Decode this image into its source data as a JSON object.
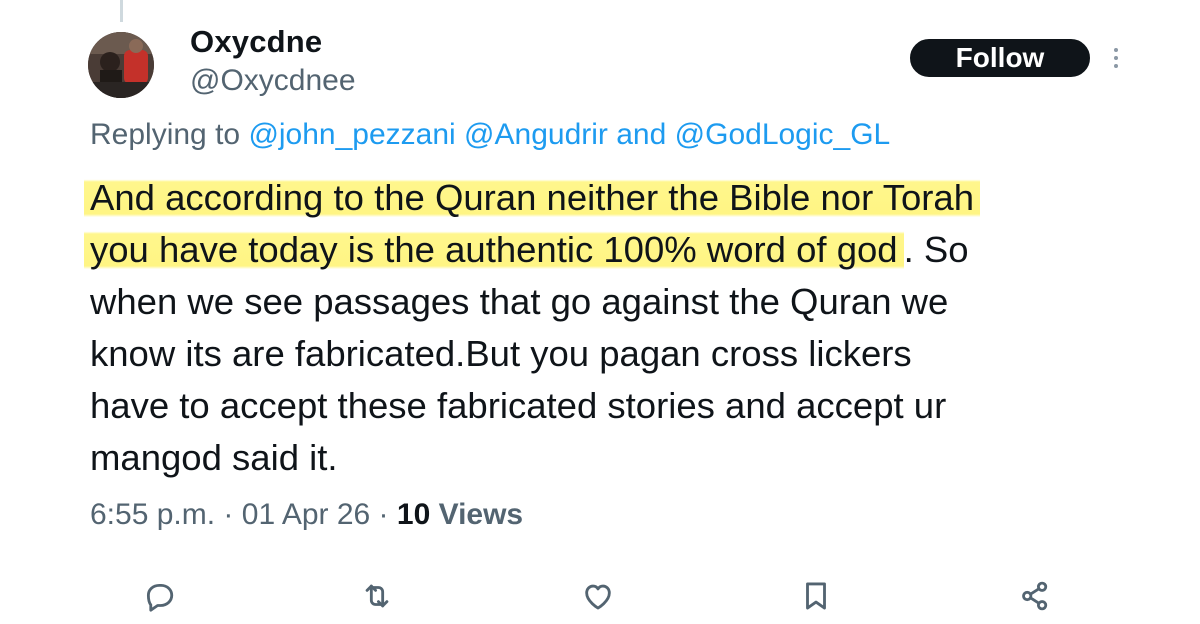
{
  "tweet": {
    "author": {
      "display_name": "Oxycdne",
      "handle": "@Oxycdnee"
    },
    "follow_label": "Follow",
    "reply_prefix": "Replying to",
    "reply_mentions": [
      "@john_pezzani",
      "@Angudrir"
    ],
    "reply_joiner": "and",
    "reply_last_mention": "@GodLogic_GL",
    "body_lines": [
      "And according to the Quran neither the Bible nor Torah",
      "you have today is the authentic 100% word of god",
      ". So",
      "when we see passages that go against the Quran we",
      "know its are fabricated.But you pagan cross lickers",
      "have to accept these fabricated stories and accept ur",
      "mangod said it."
    ],
    "time": "6:55 p.m.",
    "date": "01 Apr 26",
    "separator": "·",
    "views_count": "10",
    "views_label": "Views"
  },
  "actions": [
    {
      "name": "reply",
      "icon": "reply-icon"
    },
    {
      "name": "retweet",
      "icon": "retweet-icon"
    },
    {
      "name": "like",
      "icon": "heart-icon"
    },
    {
      "name": "bookmark",
      "icon": "bookmark-icon"
    },
    {
      "name": "share",
      "icon": "share-icon"
    }
  ],
  "colors": {
    "text": "#0f1419",
    "secondary": "#536471",
    "link": "#1d9bf0",
    "highlight": "#fff378",
    "follow_bg": "#0f1419"
  }
}
